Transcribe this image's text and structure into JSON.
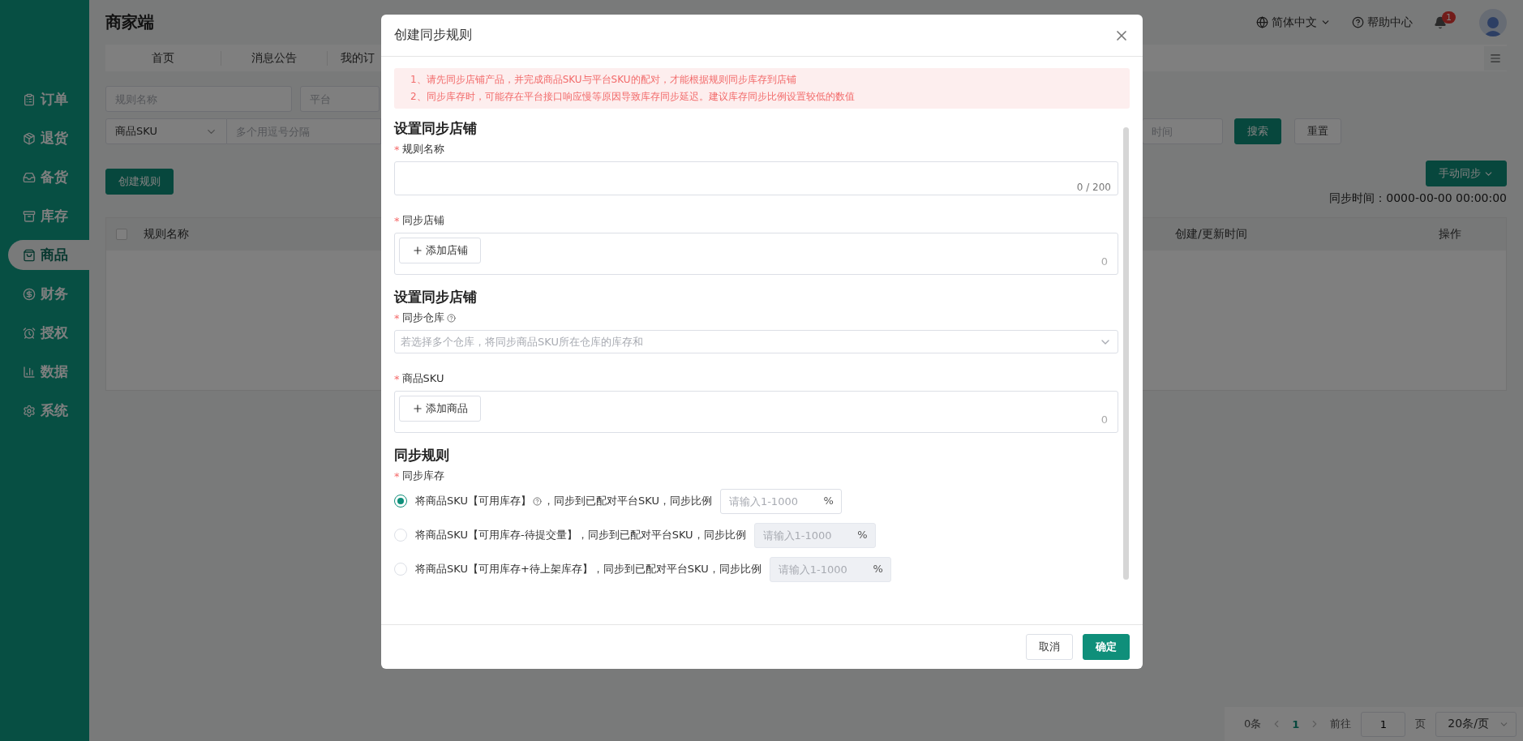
{
  "app_title": "商家端",
  "header": {
    "language": "简体中文",
    "help": "帮助中心",
    "notifications": "1"
  },
  "nav_tabs": [
    {
      "label": "首页"
    },
    {
      "label": "消息公告"
    },
    {
      "label": "我的订"
    }
  ],
  "sidebar": {
    "items": [
      {
        "label": "订单",
        "selected": false
      },
      {
        "label": "退货",
        "selected": false
      },
      {
        "label": "备货",
        "selected": false
      },
      {
        "label": "库存",
        "selected": false
      },
      {
        "label": "商品",
        "selected": true
      },
      {
        "label": "财务",
        "selected": false
      },
      {
        "label": "授权",
        "selected": false
      },
      {
        "label": "数据",
        "selected": false
      },
      {
        "label": "系统",
        "selected": false
      }
    ]
  },
  "filters": {
    "rule_name_placeholder": "规则名称",
    "platform_placeholder": "平台",
    "sku_type": "商品SKU",
    "sku_placeholder": "多个用逗号分隔",
    "time_placeholder": "时间",
    "search": "搜索",
    "reset": "重置"
  },
  "actions": {
    "create": "创建规则",
    "manual_sync": "手动同步",
    "sync_time": "同步时间：0000-00-00 00:00:00"
  },
  "table": {
    "select_all_checked": false,
    "columns": [
      "规则名称",
      "创建/更新时间",
      "操作"
    ]
  },
  "pagination": {
    "total": "0条",
    "current_page": "1",
    "goto_label": "前往",
    "goto_value": "1",
    "page_unit": "页",
    "page_size": "20条/页"
  },
  "dialog": {
    "title": "创建同步规则",
    "notices": [
      "1、请先同步店铺产品，并完成商品SKU与平台SKU的配对，才能根据规则同步库存到店铺",
      "2、同步库存时，可能存在平台接口响应慢等原因导致库存同步延迟。建议库存同步比例设置较低的数值"
    ],
    "sections": [
      {
        "title": "设置同步店铺",
        "fields": [
          {
            "kind": "textarea",
            "mark": "*",
            "label": "规则名称",
            "counter": "0 / 200"
          },
          {
            "kind": "picker",
            "mark": "*",
            "label": "同步店铺",
            "button": "添加店铺",
            "count": "0"
          }
        ]
      },
      {
        "title": "设置同步店铺",
        "fields": [
          {
            "kind": "select",
            "mark": "*",
            "label": "同步仓库",
            "help": true,
            "placeholder": "若选择多个仓库，将同步商品SKU所在仓库的库存和"
          },
          {
            "kind": "picker",
            "mark": "*",
            "label": "商品SKU",
            "button": "添加商品",
            "count": "0"
          }
        ]
      },
      {
        "title": "同步规则",
        "fields": [
          {
            "kind": "radio_group",
            "mark": "*",
            "label": "同步库存",
            "options": [
              {
                "text": "将商品SKU【可用库存】",
                "help": true,
                "text_after": "，同步到已配对平台SKU，同步比例",
                "selected": true,
                "disabled": false,
                "placeholder": "请输入1-1000",
                "suffix": "%"
              },
              {
                "text": "将商品SKU【可用库存-待提交量】，同步到已配对平台SKU，同步比例",
                "help": false,
                "selected": false,
                "disabled": true,
                "placeholder": "请输入1-1000",
                "suffix": "%"
              },
              {
                "text": "将商品SKU【可用库存+待上架库存】，同步到已配对平台SKU，同步比例",
                "help": false,
                "selected": false,
                "disabled": true,
                "placeholder": "请输入1-1000",
                "suffix": "%"
              }
            ]
          }
        ]
      }
    ],
    "cancel": "取消",
    "confirm": "确定"
  }
}
